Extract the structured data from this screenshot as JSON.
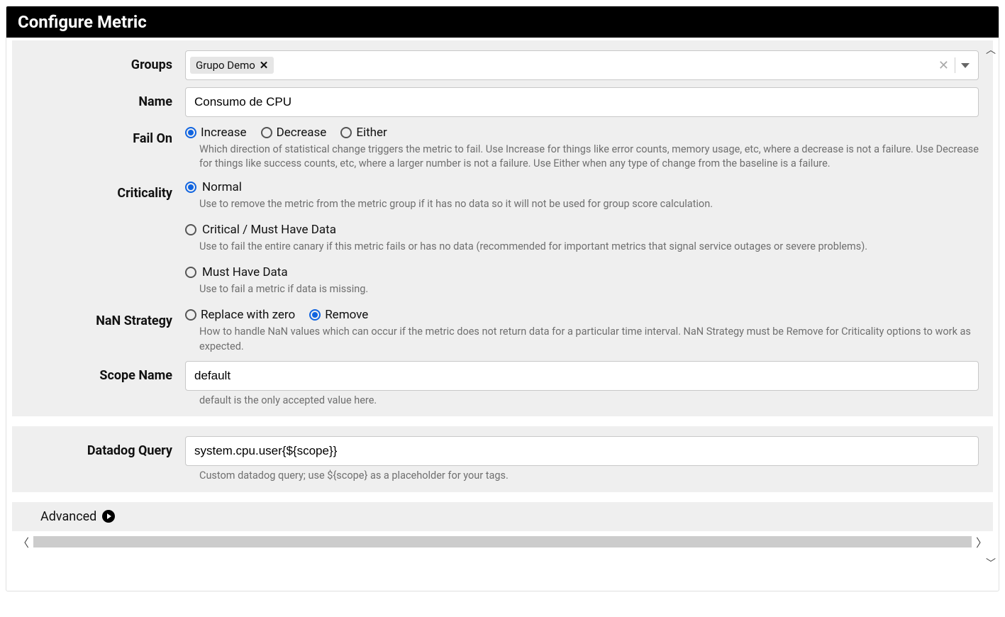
{
  "header": {
    "title": "Configure Metric"
  },
  "groups": {
    "label": "Groups",
    "chip": "Grupo Demo"
  },
  "name": {
    "label": "Name",
    "value": "Consumo de CPU"
  },
  "fail_on": {
    "label": "Fail On",
    "options": {
      "increase": "Increase",
      "decrease": "Decrease",
      "either": "Either"
    },
    "selected": "increase",
    "help": "Which direction of statistical change triggers the metric to fail. Use Increase for things like error counts, memory usage, etc, where a decrease is not a failure. Use Decrease for things like success counts, etc, where a larger number is not a failure. Use Either when any type of change from the baseline is a failure."
  },
  "criticality": {
    "label": "Criticality",
    "options": {
      "normal": {
        "label": "Normal",
        "help": "Use to remove the metric from the metric group if it has no data so it will not be used for group score calculation."
      },
      "critical": {
        "label": "Critical / Must Have Data",
        "help": "Use to fail the entire canary if this metric fails or has no data (recommended for important metrics that signal service outages or severe problems)."
      },
      "must_have": {
        "label": "Must Have Data",
        "help": "Use to fail a metric if data is missing."
      }
    },
    "selected": "normal"
  },
  "nan_strategy": {
    "label": "NaN Strategy",
    "options": {
      "replace": "Replace with zero",
      "remove": "Remove"
    },
    "selected": "remove",
    "help": "How to handle NaN values which can occur if the metric does not return data for a particular time interval. NaN Strategy must be Remove for Criticality options to work as expected."
  },
  "scope_name": {
    "label": "Scope Name",
    "value": "default",
    "help": "default is the only accepted value here."
  },
  "datadog_query": {
    "label": "Datadog Query",
    "value": "system.cpu.user{${scope}}",
    "help": "Custom datadog query; use ${scope} as a placeholder for your tags."
  },
  "advanced": {
    "label": "Advanced"
  }
}
